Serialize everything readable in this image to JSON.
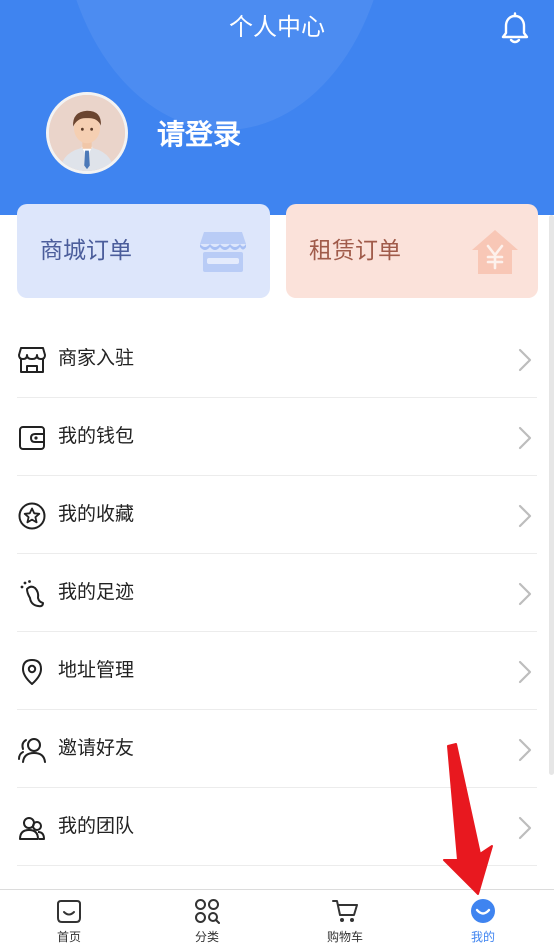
{
  "header": {
    "title": "个人中心",
    "bell_icon": "bell-icon",
    "login_text": "请登录",
    "avatar_icon": "avatar-icon",
    "colors": {
      "primary": "#3f84f0"
    }
  },
  "orders": [
    {
      "label": "商城订单",
      "icon": "store-icon"
    },
    {
      "label": "租赁订单",
      "icon": "house-yen-icon"
    }
  ],
  "menu": [
    {
      "label": "商家入驻",
      "icon": "shop-icon"
    },
    {
      "label": "我的钱包",
      "icon": "wallet-icon"
    },
    {
      "label": "我的收藏",
      "icon": "star-icon"
    },
    {
      "label": "我的足迹",
      "icon": "footprint-icon"
    },
    {
      "label": "地址管理",
      "icon": "location-pin-icon"
    },
    {
      "label": "邀请好友",
      "icon": "invite-user-icon"
    },
    {
      "label": "我的团队",
      "icon": "team-icon"
    }
  ],
  "tabbar": [
    {
      "label": "首页",
      "icon": "home-icon"
    },
    {
      "label": "分类",
      "icon": "category-icon"
    },
    {
      "label": "购物车",
      "icon": "cart-icon"
    },
    {
      "label": "我的",
      "icon": "profile-icon",
      "active": true
    }
  ]
}
